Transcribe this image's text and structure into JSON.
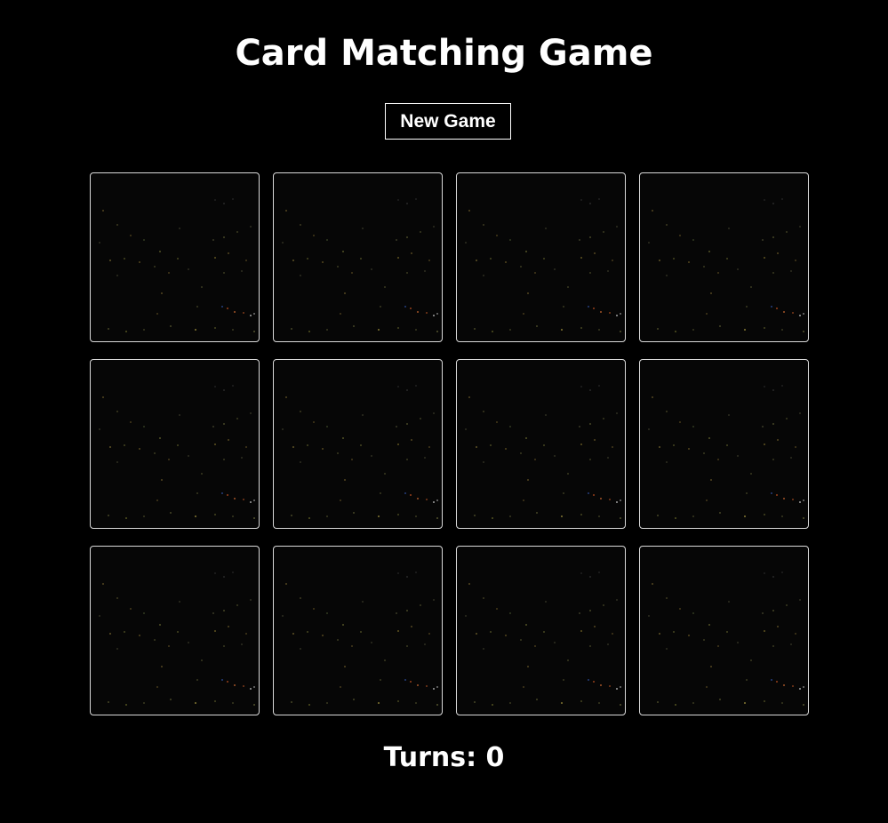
{
  "title": "Card Matching Game",
  "new_game_label": "New Game",
  "turns_label": "Turns: 0",
  "turns": 0,
  "cards": [
    {
      "face": "down"
    },
    {
      "face": "down"
    },
    {
      "face": "down"
    },
    {
      "face": "down"
    },
    {
      "face": "down"
    },
    {
      "face": "down"
    },
    {
      "face": "down"
    },
    {
      "face": "down"
    },
    {
      "face": "down"
    },
    {
      "face": "down"
    },
    {
      "face": "down"
    },
    {
      "face": "down"
    }
  ],
  "card_back": "night-city-lights",
  "colors": {
    "background": "#000000",
    "text": "#ffffff",
    "card_border": "#d9d9d9",
    "card_back": "#060606"
  }
}
